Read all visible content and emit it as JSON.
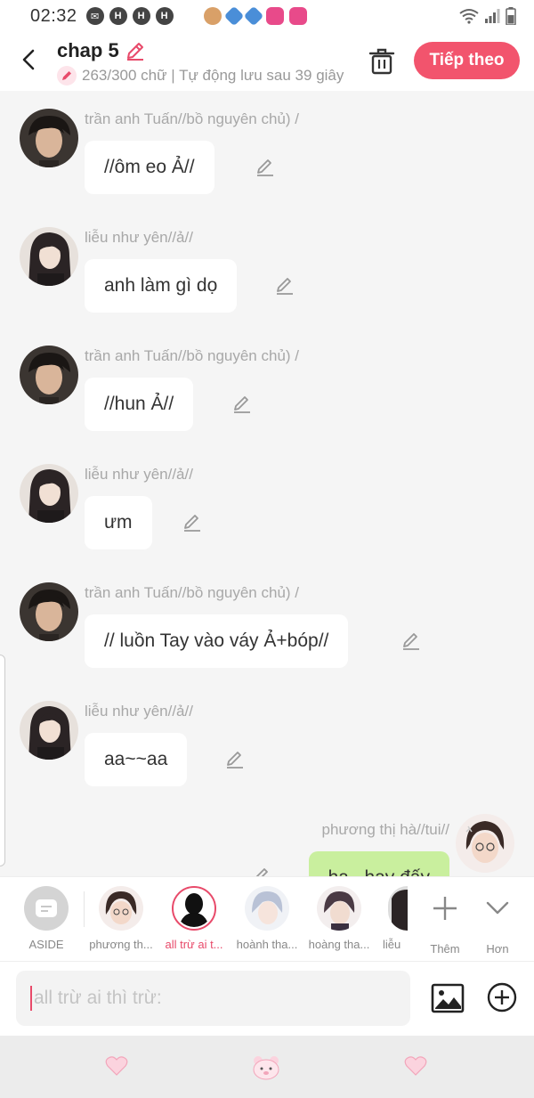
{
  "status": {
    "time": "02:32",
    "notif_letters": [
      "H",
      "H",
      "H"
    ]
  },
  "header": {
    "title": "chap 5",
    "subtitle": "263/300 chữ | Tự động lưu sau 39 giây",
    "next_label": "Tiếp theo"
  },
  "messages": [
    {
      "sender": "trần anh Tuấn//bồ nguyên chủ) /",
      "text": "//ôm eo Ả//"
    },
    {
      "sender": "liễu như yên//ả//",
      "text": "anh làm gì dọ"
    },
    {
      "sender": "trần anh Tuấn//bồ nguyên chủ) /",
      "text": "//hun Ả//"
    },
    {
      "sender": "liễu như yên//ả//",
      "text": "ưm"
    },
    {
      "sender": "trần anh Tuấn//bồ nguyên chủ) /",
      "text": "// luồn Tay vào váy Ả+bóp//"
    },
    {
      "sender": "liễu như yên//ả//",
      "text": "aa~~aa"
    }
  ],
  "self_message": {
    "sender": "phương thị hà//tui//",
    "text": "ha...hay đấy"
  },
  "characters": {
    "aside_label": "ASIDE",
    "items": [
      {
        "name": "phương th..."
      },
      {
        "name": "all trừ ai t..."
      },
      {
        "name": "hoành tha..."
      },
      {
        "name": "hoàng tha..."
      },
      {
        "name": "liễu"
      }
    ],
    "more_label": "Thêm",
    "collapse_label": "Hơn"
  },
  "input": {
    "placeholder": "all trừ ai thì trừ:"
  },
  "colors": {
    "accent": "#f2546d",
    "self_bubble": "#c9ef9e"
  }
}
